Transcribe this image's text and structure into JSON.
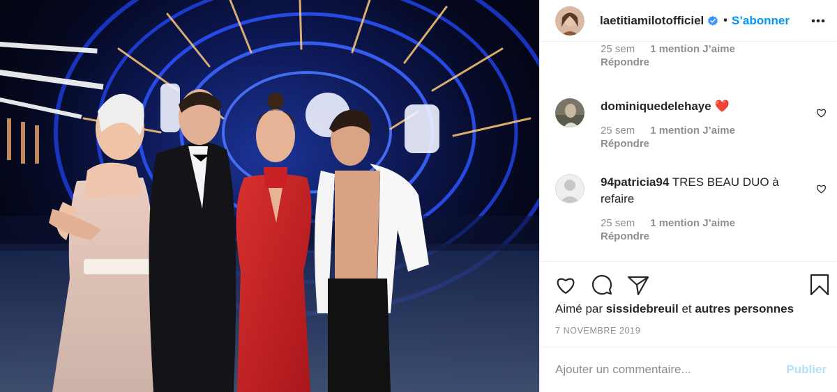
{
  "post": {
    "author": "laetitiamilotofficiel",
    "follow_label": "S’abonner",
    "separator": "•",
    "photo_alt": "Photo"
  },
  "comments": [
    {
      "username": "",
      "text": "",
      "age": "25 sem",
      "likes": "1 mention J’aime",
      "reply": "Répondre"
    },
    {
      "username": "dominiquedelehaye",
      "text": "❤️",
      "age": "25 sem",
      "likes": "1 mention J’aime",
      "reply": "Répondre"
    },
    {
      "username": "94patricia94",
      "text": "TRES BEAU DUO à refaire",
      "age": "25 sem",
      "likes": "1 mention J’aime",
      "reply": "Répondre"
    }
  ],
  "likes_line": {
    "prefix": "Aimé par",
    "user": "sissidebreuil",
    "joiner": "et",
    "others": "autres personnes"
  },
  "date": "7 NOVEMBRE 2019",
  "add_comment": {
    "placeholder": "Ajouter un commentaire...",
    "publish_label": "Publier"
  },
  "icons": {
    "verified": "verified-badge-icon",
    "more": "more-options-icon",
    "like": "heart-icon",
    "comment": "comment-icon",
    "share": "share-icon",
    "save": "bookmark-icon"
  },
  "colors": {
    "accent": "#0095f6",
    "publish_disabled": "#b2dffc",
    "muted": "#8e8e8e",
    "text": "#262626"
  }
}
